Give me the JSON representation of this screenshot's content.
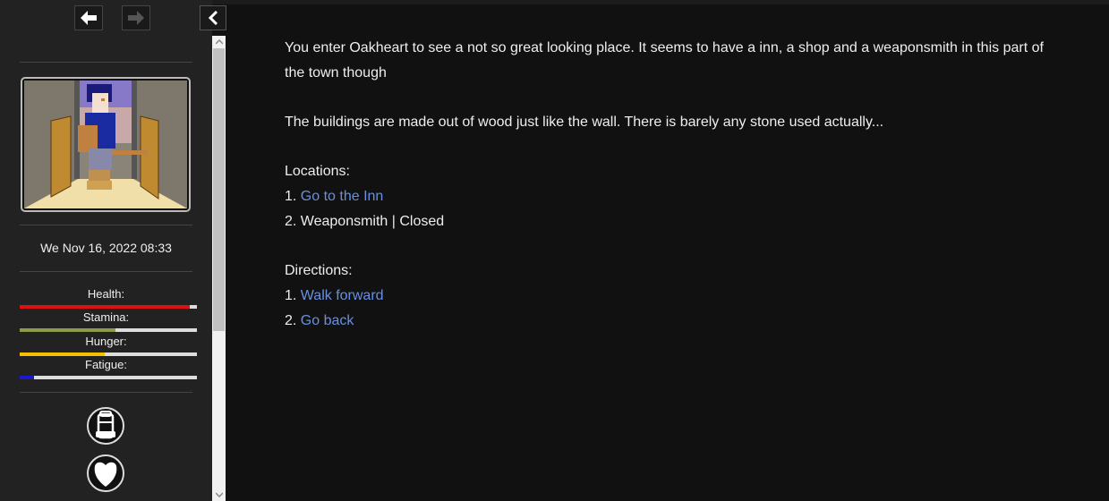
{
  "sidebar": {
    "datetime": "We Nov 16, 2022 08:33",
    "stats": [
      {
        "label": "Health:",
        "fraction": 0.96,
        "color": "#dd1111"
      },
      {
        "label": "Stamina:",
        "fraction": 0.54,
        "color": "#8c9a4a"
      },
      {
        "label": "Hunger:",
        "fraction": 0.48,
        "color": "#f5c000"
      },
      {
        "label": "Fatigue:",
        "fraction": 0.08,
        "color": "#1a1ad0"
      }
    ],
    "icons": [
      "backpack-icon",
      "heart-icon"
    ]
  },
  "passage": {
    "intro1": "You enter Oakheart to see a not so great looking place. It seems to have a inn, a shop and a weaponsmith in this part of the town though",
    "intro2": "The buildings are made out of wood just like the wall. There is barely any stone used actually...",
    "locations_heading": "Locations:",
    "locations": [
      {
        "num": "1.",
        "text": "Go to the Inn",
        "link": true
      },
      {
        "num": "2.",
        "text": "Weaponsmith | Closed",
        "link": false
      }
    ],
    "directions_heading": "Directions:",
    "directions": [
      {
        "num": "1.",
        "text": "Walk forward",
        "link": true
      },
      {
        "num": "2.",
        "text": "Go back",
        "link": true
      }
    ]
  },
  "colors": {
    "background": "#111111",
    "sidebar": "#222222",
    "link": "#6a8fe0",
    "text": "#eeeeee"
  }
}
